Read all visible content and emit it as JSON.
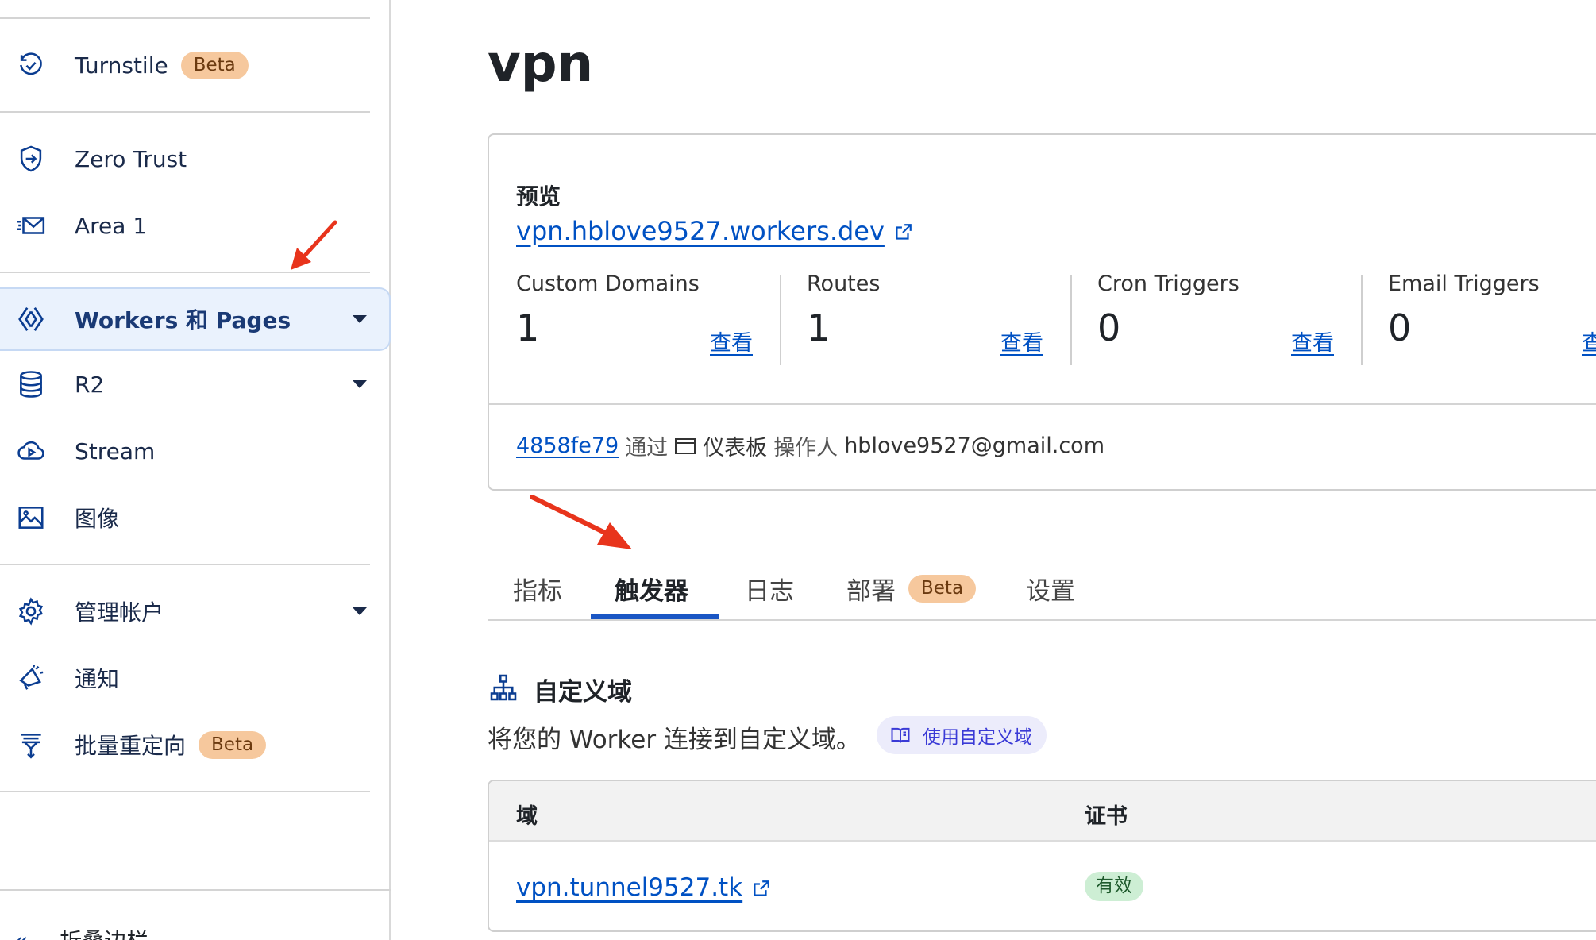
{
  "sidebar": {
    "items": [
      {
        "label": "Turnstile",
        "badge": "Beta",
        "icon": "turnstile-icon"
      },
      {
        "label": "Zero Trust",
        "icon": "zero-trust-icon"
      },
      {
        "label": "Area 1",
        "icon": "mail-icon"
      },
      {
        "label": "Workers 和 Pages",
        "icon": "workers-icon",
        "active": true
      },
      {
        "label": "R2",
        "icon": "database-icon"
      },
      {
        "label": "Stream",
        "icon": "cloud-play-icon"
      },
      {
        "label": "图像",
        "icon": "image-icon"
      },
      {
        "label": "管理帐户",
        "icon": "gear-icon"
      },
      {
        "label": "通知",
        "icon": "megaphone-icon"
      },
      {
        "label": "批量重定向",
        "badge": "Beta",
        "icon": "redirect-icon"
      }
    ],
    "collapse_label": "折叠边栏"
  },
  "page": {
    "title": "vpn"
  },
  "preview": {
    "heading": "预览",
    "url": "vpn.hblove9527.workers.dev",
    "stats": [
      {
        "label": "Custom Domains",
        "value": "1",
        "link": "查看"
      },
      {
        "label": "Routes",
        "value": "1",
        "link": "查看"
      },
      {
        "label": "Cron Triggers",
        "value": "0",
        "link": "查看"
      },
      {
        "label": "Email Triggers",
        "value": "0",
        "link": "查看"
      }
    ],
    "deployment": {
      "commit": "4858fe79",
      "via": "通过",
      "source": "仪表板",
      "operator_label": "操作人",
      "operator": "hblove9527@gmail.com"
    }
  },
  "tabs": [
    {
      "label": "指标"
    },
    {
      "label": "触发器",
      "active": true
    },
    {
      "label": "日志"
    },
    {
      "label": "部署",
      "badge": "Beta"
    },
    {
      "label": "设置"
    }
  ],
  "custom_domains": {
    "title": "自定义域",
    "description": "将您的 Worker 连接到自定义域。",
    "docs_link": "使用自定义域",
    "columns": [
      "域",
      "证书"
    ],
    "rows": [
      {
        "domain": "vpn.tunnel9527.tk",
        "certificate": "有效"
      }
    ]
  },
  "colors": {
    "accent": "#0051c3",
    "active_tab": "#1a56c4",
    "beta_badge": "#f6c89d",
    "valid_badge": "#cdeed4",
    "annotation_arrow": "#e8341c"
  }
}
